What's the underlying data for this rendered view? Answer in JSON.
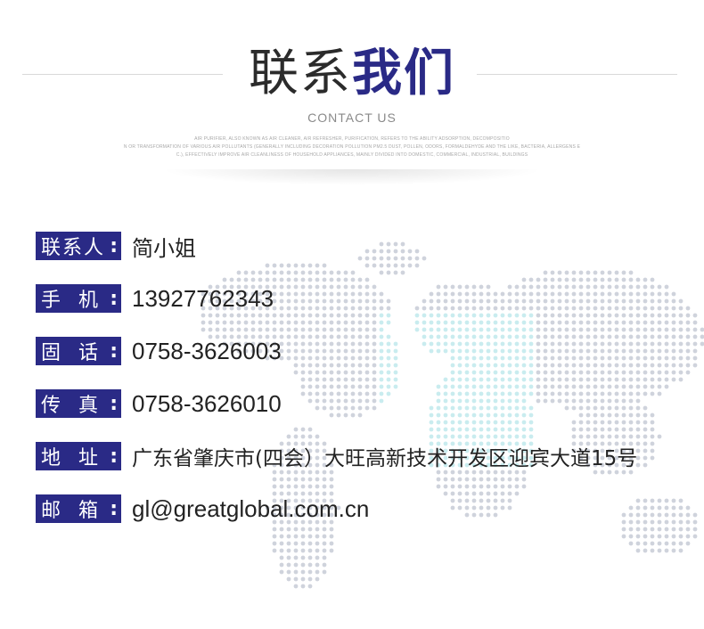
{
  "header": {
    "title_light": "联系",
    "title_bold": "我们",
    "subtitle": "CONTACT US",
    "micro_lines": [
      "AIR PURIFIER, ALSO KNOWN AS AIR CLEANER, AIR REFRESHER, PURIFICATION, REFERS TO THE ABILITY ADSORPTION, DECOMPOSITIO",
      "N OR TRANSFORMATION OF VARIOUS AIR POLLUTANTS (GENERALLY INCLUDING DECORATION POLLUTION PM2.5 DUST, POLLEN, ODORS, FORMALDEHYDE AND THE LIKE, BACTERIA, ALLERGENS E",
      "C.), EFFECTIVELY IMPROVE AIR CLEANLINESS OF HOUSEHOLD APPLIANCES, MAINLY DIVIDED INTO DOMESTIC, COMMERCIAL, INDUSTRIAL, BUILDINGS"
    ]
  },
  "contacts": [
    {
      "label": "联系人",
      "colon": ":",
      "value": "简小姐"
    },
    {
      "label": "手  机",
      "colon": ":",
      "value": "13927762343"
    },
    {
      "label": "固  话",
      "colon": ":",
      "value": "0758-3626003"
    },
    {
      "label": "传  真",
      "colon": ":",
      "value": "0758-3626010"
    },
    {
      "label": "地  址",
      "colon": ":",
      "value": "广东省肇庆市(四会）大旺高新技术开发区迎宾大道15号"
    },
    {
      "label": "邮  箱",
      "colon": ":",
      "value": "gl@greatglobal.com.cn"
    }
  ],
  "colors": {
    "accent": "#2a2a86",
    "map_dot_gray": "#cfd3dc",
    "map_dot_cyan": "#c9ecef"
  }
}
